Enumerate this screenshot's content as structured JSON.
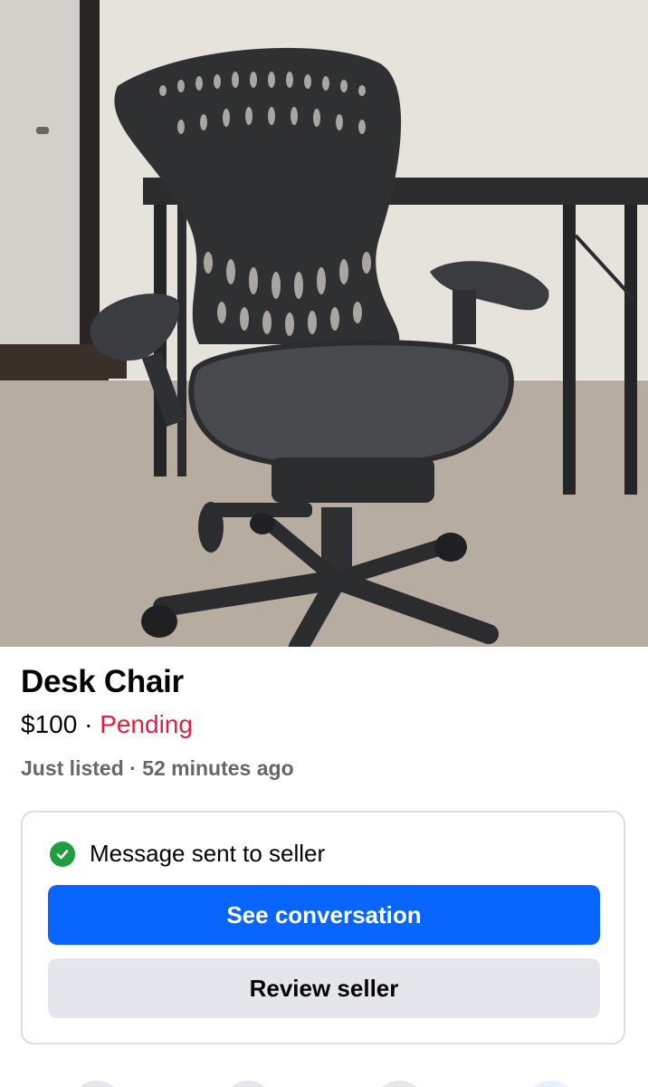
{
  "listing": {
    "title": "Desk Chair",
    "price": "$100",
    "separator": " · ",
    "status": "Pending",
    "listed_text": "Just listed · 52 minutes ago"
  },
  "message_card": {
    "sent_text": "Message sent to seller",
    "primary_button": "See conversation",
    "secondary_button": "Review seller"
  },
  "colors": {
    "accent": "#0866ff",
    "status_pending": "#e41e3f",
    "success": "#1e9e41",
    "secondary_button_bg": "#e4e6eb"
  },
  "icons": [
    "check-circle-icon"
  ]
}
